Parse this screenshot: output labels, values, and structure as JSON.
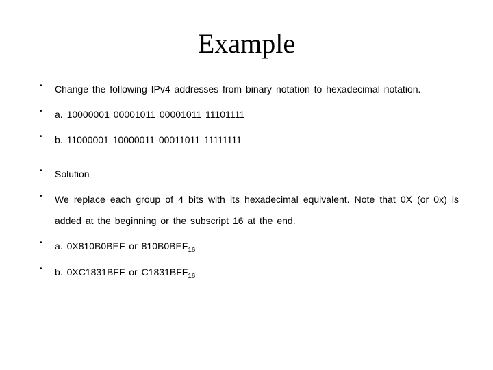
{
  "title": "Example",
  "items": {
    "i0": "Change the following IPv4 addresses from binary notation to hexadecimal notation.",
    "i1": "a. 10000001 00001011 00001011 11101111",
    "i2": "b. 11000001 10000011 00011011 11111111",
    "i3": "Solution",
    "i4": "We replace each group of 4 bits with its hexadecimal equivalent. Note that 0X (or 0x) is added at the beginning or the subscript 16 at the end.",
    "i5a": "a. 0X810B0BEF or 810B0BEF",
    "i5sub": "16",
    "i6a": "b. 0XC1831BFF or C1831BFF",
    "i6sub": "16"
  }
}
